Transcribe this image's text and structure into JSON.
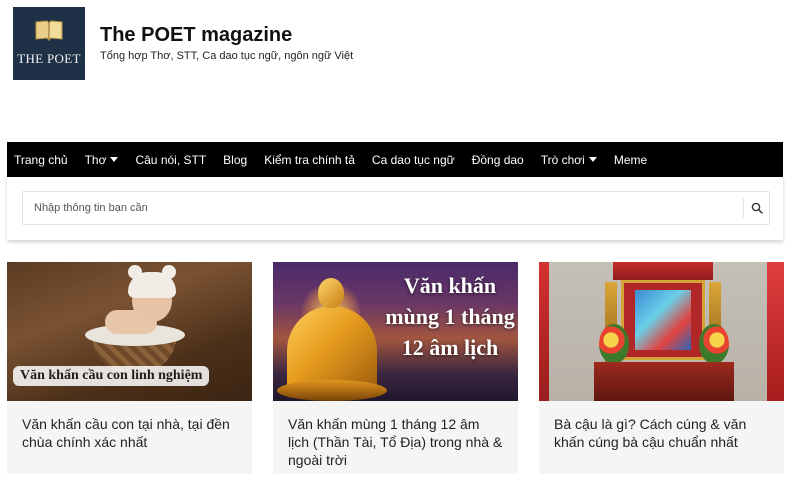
{
  "header": {
    "logo_text": "THE POET",
    "site_title": "The POET magazine",
    "tagline": "Tổng hợp Thơ, STT, Ca dao tục ngữ, ngôn ngữ Việt"
  },
  "nav": {
    "items": [
      {
        "label": "Trang chủ",
        "dropdown": false
      },
      {
        "label": "Thơ",
        "dropdown": true
      },
      {
        "label": "Câu nói, STT",
        "dropdown": false
      },
      {
        "label": "Blog",
        "dropdown": false
      },
      {
        "label": "Kiểm tra chính tả",
        "dropdown": false
      },
      {
        "label": "Ca dao tục ngữ",
        "dropdown": false
      },
      {
        "label": "Đồng dao",
        "dropdown": false
      },
      {
        "label": "Trò chơi",
        "dropdown": true
      },
      {
        "label": "Meme",
        "dropdown": false
      }
    ]
  },
  "search": {
    "placeholder": "Nhập thông tin bạn cần",
    "value": "",
    "icon": "search-icon"
  },
  "cards": [
    {
      "image_caption": "Văn khấn cầu con linh nghiệm",
      "title": "Văn khấn cầu con tại nhà, tại đền chùa chính xác nhất"
    },
    {
      "image_caption": "Văn khấn mùng 1 tháng 12 âm lịch",
      "title": "Văn khấn mùng 1 tháng 12 âm lịch (Thần Tài, Tổ Địa) trong nhà & ngoài trời"
    },
    {
      "image_caption": "",
      "title": "Bà cậu là gì? Cách cúng & văn khấn cúng bà cậu chuẩn nhất"
    }
  ],
  "colors": {
    "logo_bg": "#1f3147",
    "nav_bg": "#000000",
    "nav_text": "#ffffff",
    "card_bg": "#f5f5f5"
  }
}
